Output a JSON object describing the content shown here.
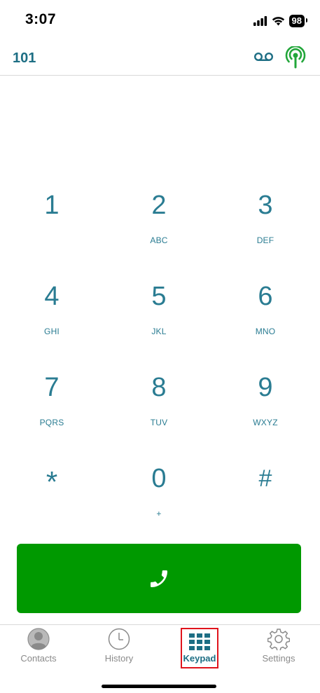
{
  "status": {
    "time": "3:07",
    "battery": "98"
  },
  "header": {
    "extension": "101"
  },
  "keypad": [
    {
      "digit": "1",
      "letters": ""
    },
    {
      "digit": "2",
      "letters": "ABC"
    },
    {
      "digit": "3",
      "letters": "DEF"
    },
    {
      "digit": "4",
      "letters": "GHI"
    },
    {
      "digit": "5",
      "letters": "JKL"
    },
    {
      "digit": "6",
      "letters": "MNO"
    },
    {
      "digit": "7",
      "letters": "PQRS"
    },
    {
      "digit": "8",
      "letters": "TUV"
    },
    {
      "digit": "9",
      "letters": "WXYZ"
    },
    {
      "digit": "*",
      "letters": ""
    },
    {
      "digit": "0",
      "letters": "+"
    },
    {
      "digit": "#",
      "letters": ""
    }
  ],
  "tabs": [
    {
      "label": "Contacts",
      "icon": "contacts-icon"
    },
    {
      "label": "History",
      "icon": "history-icon"
    },
    {
      "label": "Keypad",
      "icon": "keypad-icon",
      "active": true
    },
    {
      "label": "Settings",
      "icon": "settings-icon"
    }
  ],
  "colors": {
    "accent": "#1d6e84",
    "digit": "#2a7c92",
    "call": "#009900",
    "signal": "#22a63a"
  }
}
